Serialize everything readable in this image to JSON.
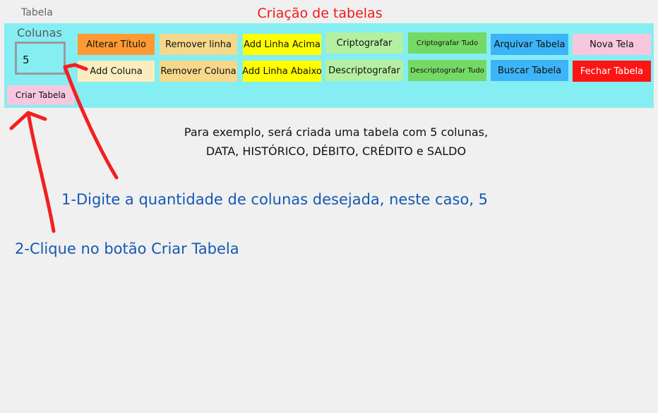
{
  "window": {
    "title": "Tabela"
  },
  "heading": "Criação de tabelas",
  "toolbar": {
    "colunas_label": "Colunas",
    "colunas_value": "5",
    "create_button": {
      "label": "Criar Tabela",
      "color": "#f7c7df"
    },
    "buttons_row1": [
      {
        "label": "Alterar Título",
        "color": "#ff9a33"
      },
      {
        "label": "Remover linha",
        "color": "#f5d88a"
      },
      {
        "label": "Add Linha Acima",
        "color": "#ffff00"
      },
      {
        "label": "Criptografar",
        "color": "#b5f0a2"
      },
      {
        "label": "Criptografar Tudo",
        "color": "#75d965"
      },
      {
        "label": "Arquivar Tabela",
        "color": "#3db4f7"
      },
      {
        "label": "Nova Tela",
        "color": "#f7c7df"
      }
    ],
    "buttons_row2": [
      {
        "label": "Add Coluna",
        "color": "#fbedc0"
      },
      {
        "label": "Remover Coluna",
        "color": "#f5d88a"
      },
      {
        "label": "Add Linha Abaixo",
        "color": "#ffff00"
      },
      {
        "label": "Descriptografar",
        "color": "#b5f0a2"
      },
      {
        "label": "Descriptografar Tudo",
        "color": "#75d965"
      },
      {
        "label": "Buscar Tabela",
        "color": "#3db4f7"
      },
      {
        "label": "Fechar Tabela",
        "color": "#fc1515"
      }
    ]
  },
  "instruction": {
    "line1": "Para exemplo, será criada uma tabela com 5 colunas,",
    "line2": "DATA, HISTÓRICO, DÉBITO, CRÉDITO e SALDO"
  },
  "steps": {
    "step1": "1-Digite a quantidade de colunas desejada, neste caso, 5",
    "step2": "2-Clique no botão Criar Tabela"
  },
  "annotation_color": "#f22020"
}
